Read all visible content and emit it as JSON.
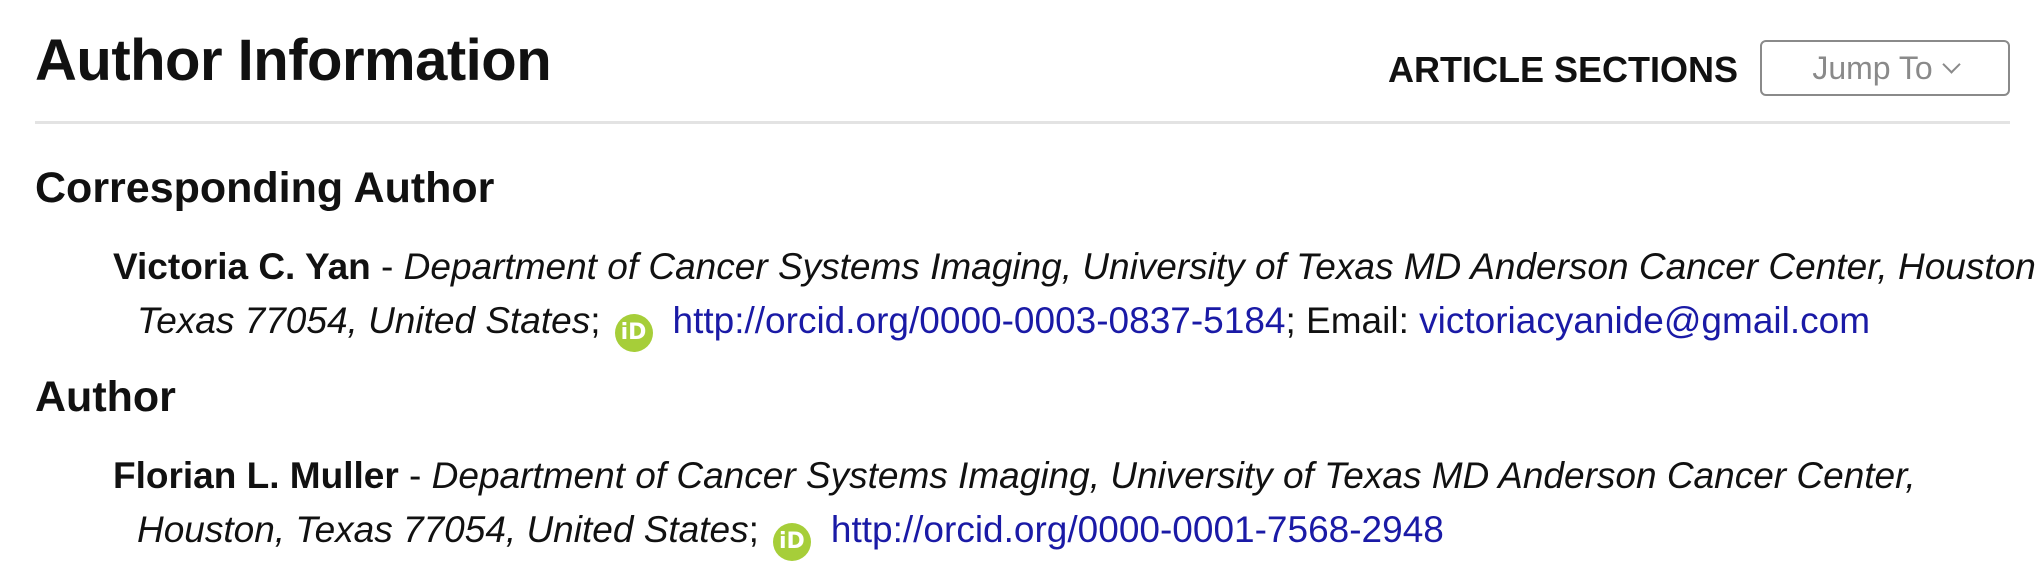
{
  "header": {
    "title": "Author Information",
    "sections_label": "ARTICLE SECTIONS",
    "jump_button_label": "Jump To"
  },
  "corresponding": {
    "section_title": "Corresponding Author",
    "name": "Victoria C. Yan",
    "separator": " - ",
    "affiliation_line1": "Department of Cancer Systems Imaging, University of Texas MD Anderson Cancer Center, Houston,",
    "affiliation_line2": "Texas 77054, United States",
    "semicolon": ";",
    "orcid_icon_text": "iD",
    "orcid_url": "http://orcid.org/0000-0003-0837-5184",
    "email_label": "; Email: ",
    "email": "victoriacyanide@gmail.com"
  },
  "author": {
    "section_title": "Author",
    "name": "Florian L. Muller",
    "separator": " - ",
    "affiliation_line1": "Department of Cancer Systems Imaging, University of Texas MD Anderson Cancer Center,",
    "affiliation_line2": "Houston, Texas 77054, United States",
    "semicolon": ";",
    "orcid_icon_text": "iD",
    "orcid_url": "http://orcid.org/0000-0001-7568-2948"
  }
}
